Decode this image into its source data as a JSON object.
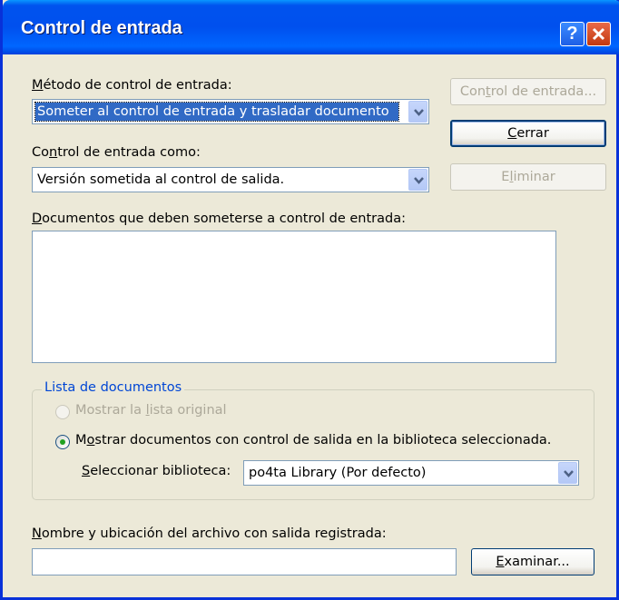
{
  "window": {
    "title": "Control de entrada",
    "help_label": "?"
  },
  "method": {
    "label_u": "M",
    "label_rest": "étodo de control de entrada:",
    "value": "Someter al control de entrada y trasladar documento"
  },
  "checkin_as": {
    "label_pre": "Co",
    "label_u": "n",
    "label_rest": "trol de entrada como:",
    "value": "Versión sometida al control de salida."
  },
  "documents": {
    "label_u": "D",
    "label_rest": "ocumentos que deben someterse a control de entrada:",
    "items": []
  },
  "buttons": {
    "checkin_pre": "Con",
    "checkin_u": "t",
    "checkin_rest": "rol de entrada...",
    "close_u": "C",
    "close_rest": "errar",
    "delete_pre": "E",
    "delete_u": "l",
    "delete_rest": "iminar",
    "browse_u": "E",
    "browse_rest": "xaminar..."
  },
  "doc_list_group": {
    "legend": "Lista de documentos",
    "option_original_pre": "Mostrar la ",
    "option_original_u": "l",
    "option_original_rest": "ista original",
    "option_checked_pre": "M",
    "option_checked_u": "o",
    "option_checked_rest": "strar documentos con control de salida en la biblioteca seleccionada.",
    "selected_option": "option_checked",
    "library_label_u": "S",
    "library_label_rest": "eleccionar biblioteca:",
    "library_value": "po4ta Library  (Por defecto)"
  },
  "checkout_file": {
    "label_u": "N",
    "label_rest": "ombre y ubicación del archivo con salida registrada:",
    "value": ""
  },
  "colors": {
    "titlebar": "#0053ee",
    "dialog_bg": "#ece9d8",
    "selection": "#316ac5",
    "legend_text": "#0046d5",
    "disabled_text": "#aca899"
  }
}
